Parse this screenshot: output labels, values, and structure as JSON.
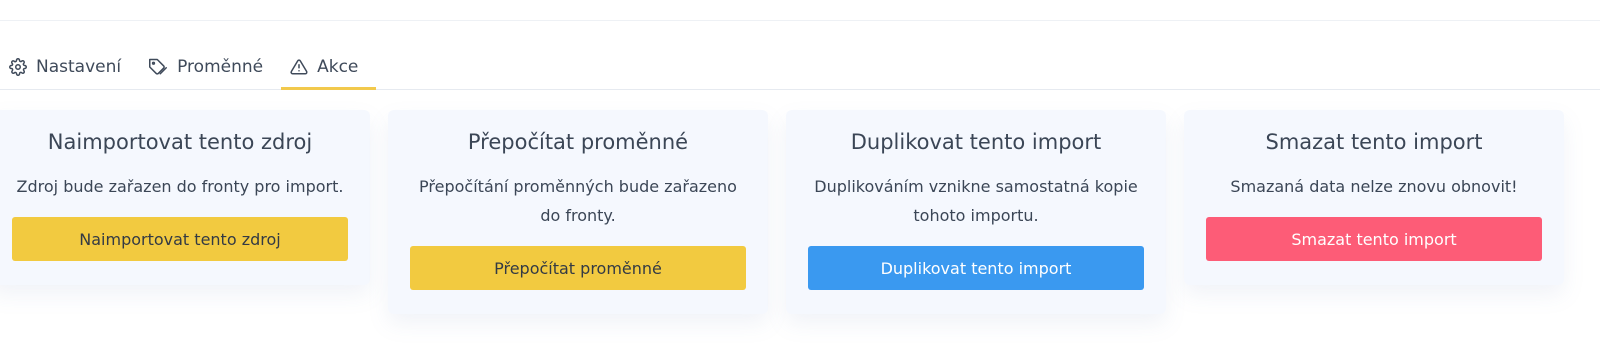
{
  "tabs": [
    {
      "label": "Nastavení",
      "icon": "gear-icon"
    },
    {
      "label": "Proměnné",
      "icon": "tag-icon"
    },
    {
      "label": "Akce",
      "icon": "warning-icon"
    }
  ],
  "cards": [
    {
      "title": "Naimportovat tento zdroj",
      "description": "Zdroj bude zařazen do fronty pro import.",
      "button": "Naimportovat tento zdroj",
      "button_color": "#f2ca40"
    },
    {
      "title": "Přepočítat proměnné",
      "description": "Přepočítání proměnných bude zařazeno do fronty.",
      "button": "Přepočítat proměnné",
      "button_color": "#f2ca40"
    },
    {
      "title": "Duplikovat tento import",
      "description": "Duplikováním vznikne samostatná kopie tohoto importu.",
      "button": "Duplikovat tento import",
      "button_color": "#3a99f0"
    },
    {
      "title": "Smazat tento import",
      "description": "Smazaná data nelze znovu obnovit!",
      "button": "Smazat tento import",
      "button_color": "#fd5c77"
    }
  ],
  "colors": {
    "active_tab_underline": "#f2c94c",
    "card_background": "#f5f8fe"
  }
}
